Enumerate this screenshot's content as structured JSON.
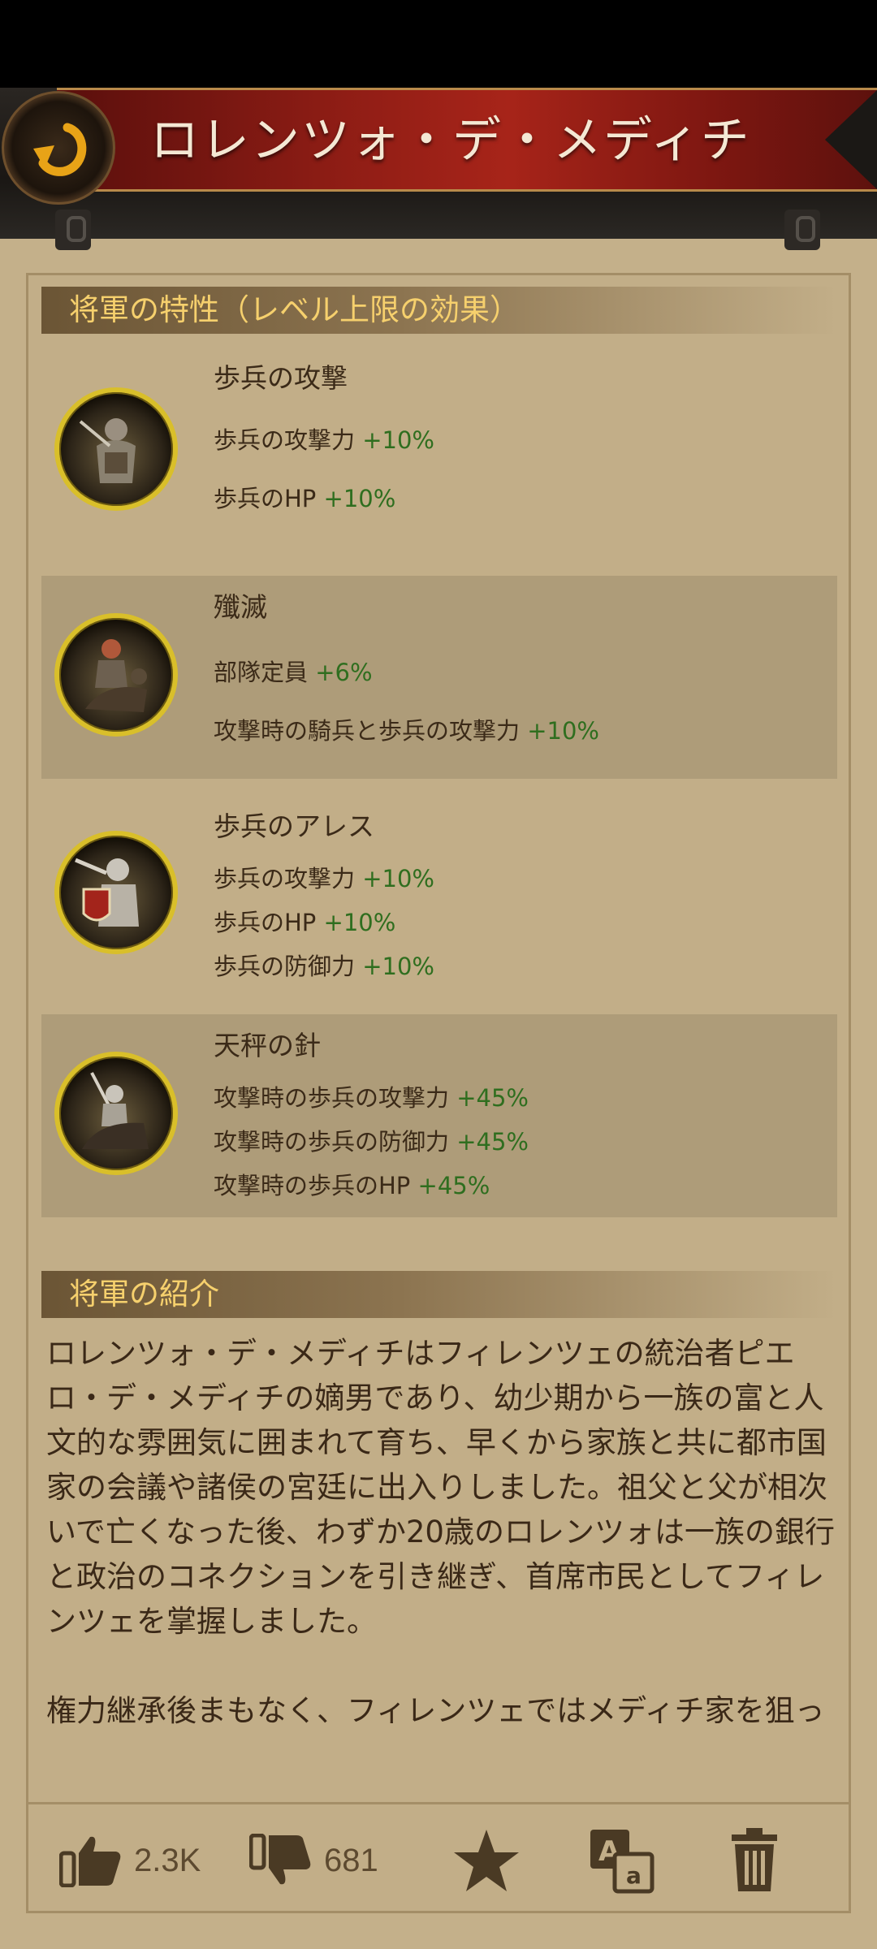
{
  "header": {
    "title": "ロレンツォ・デ・メディチ",
    "back_icon": "back-arrow-icon"
  },
  "traits_section": {
    "heading": "将軍の特性（レベル上限の効果）"
  },
  "traits": [
    {
      "name": "歩兵の攻撃",
      "portrait": "infantry-knight-portrait",
      "stats": [
        {
          "label": "歩兵の攻撃力",
          "value": "+10%"
        },
        {
          "label": "歩兵のHP",
          "value": "+10%"
        }
      ]
    },
    {
      "name": "殲滅",
      "portrait": "cavalry-rider-portrait",
      "stats": [
        {
          "label": "部隊定員",
          "value": "+6%"
        },
        {
          "label": "攻撃時の騎兵と歩兵の攻撃力",
          "value": "+10%"
        }
      ]
    },
    {
      "name": "歩兵のアレス",
      "portrait": "armored-shield-knight-portrait",
      "stats": [
        {
          "label": "歩兵の攻撃力",
          "value": "+10%"
        },
        {
          "label": "歩兵のHP",
          "value": "+10%"
        },
        {
          "label": "歩兵の防御力",
          "value": "+10%"
        }
      ]
    },
    {
      "name": "天秤の針",
      "portrait": "mounted-lancer-portrait",
      "stats": [
        {
          "label": "攻撃時の歩兵の攻撃力",
          "value": "+45%"
        },
        {
          "label": "攻撃時の歩兵の防御力",
          "value": "+45%"
        },
        {
          "label": "攻撃時の歩兵のHP",
          "value": "+45%"
        }
      ]
    }
  ],
  "intro_section": {
    "heading": "将軍の紹介"
  },
  "bio": {
    "text": "ロレンツォ・デ・メディチはフィレンツェの統治者ピエロ・デ・メディチの嫡男であり、幼少期から一族の富と人文的な雰囲気に囲まれて育ち、早くから家族と共に都市国家の会議や諸侯の宮廷に出入りしました。祖父と父が相次いで亡くなった後、わずか20歳のロレンツォは一族の銀行と政治のコネクションを引き継ぎ、首席市民としてフィレンツェを掌握しました。\n\n権力継承後まもなく、フィレンツェではメディチ家を狙ったパッツィの陰謀が発生しました。ロレンツォの弟はその場で死亡し、ロレンツォ自身も暗殺されかけ"
  },
  "actions": {
    "like": {
      "icon": "thumbs-up-icon",
      "count": "2.3K"
    },
    "dislike": {
      "icon": "thumbs-down-icon",
      "count": "681"
    },
    "favorite": {
      "icon": "star-icon"
    },
    "translate": {
      "icon": "translate-icon"
    },
    "delete": {
      "icon": "trash-icon"
    }
  },
  "colors": {
    "accent_gold": "#f6d06d",
    "stat_green": "#2f6e1f",
    "banner_red": "#a72419",
    "background": "#c4b08a"
  }
}
